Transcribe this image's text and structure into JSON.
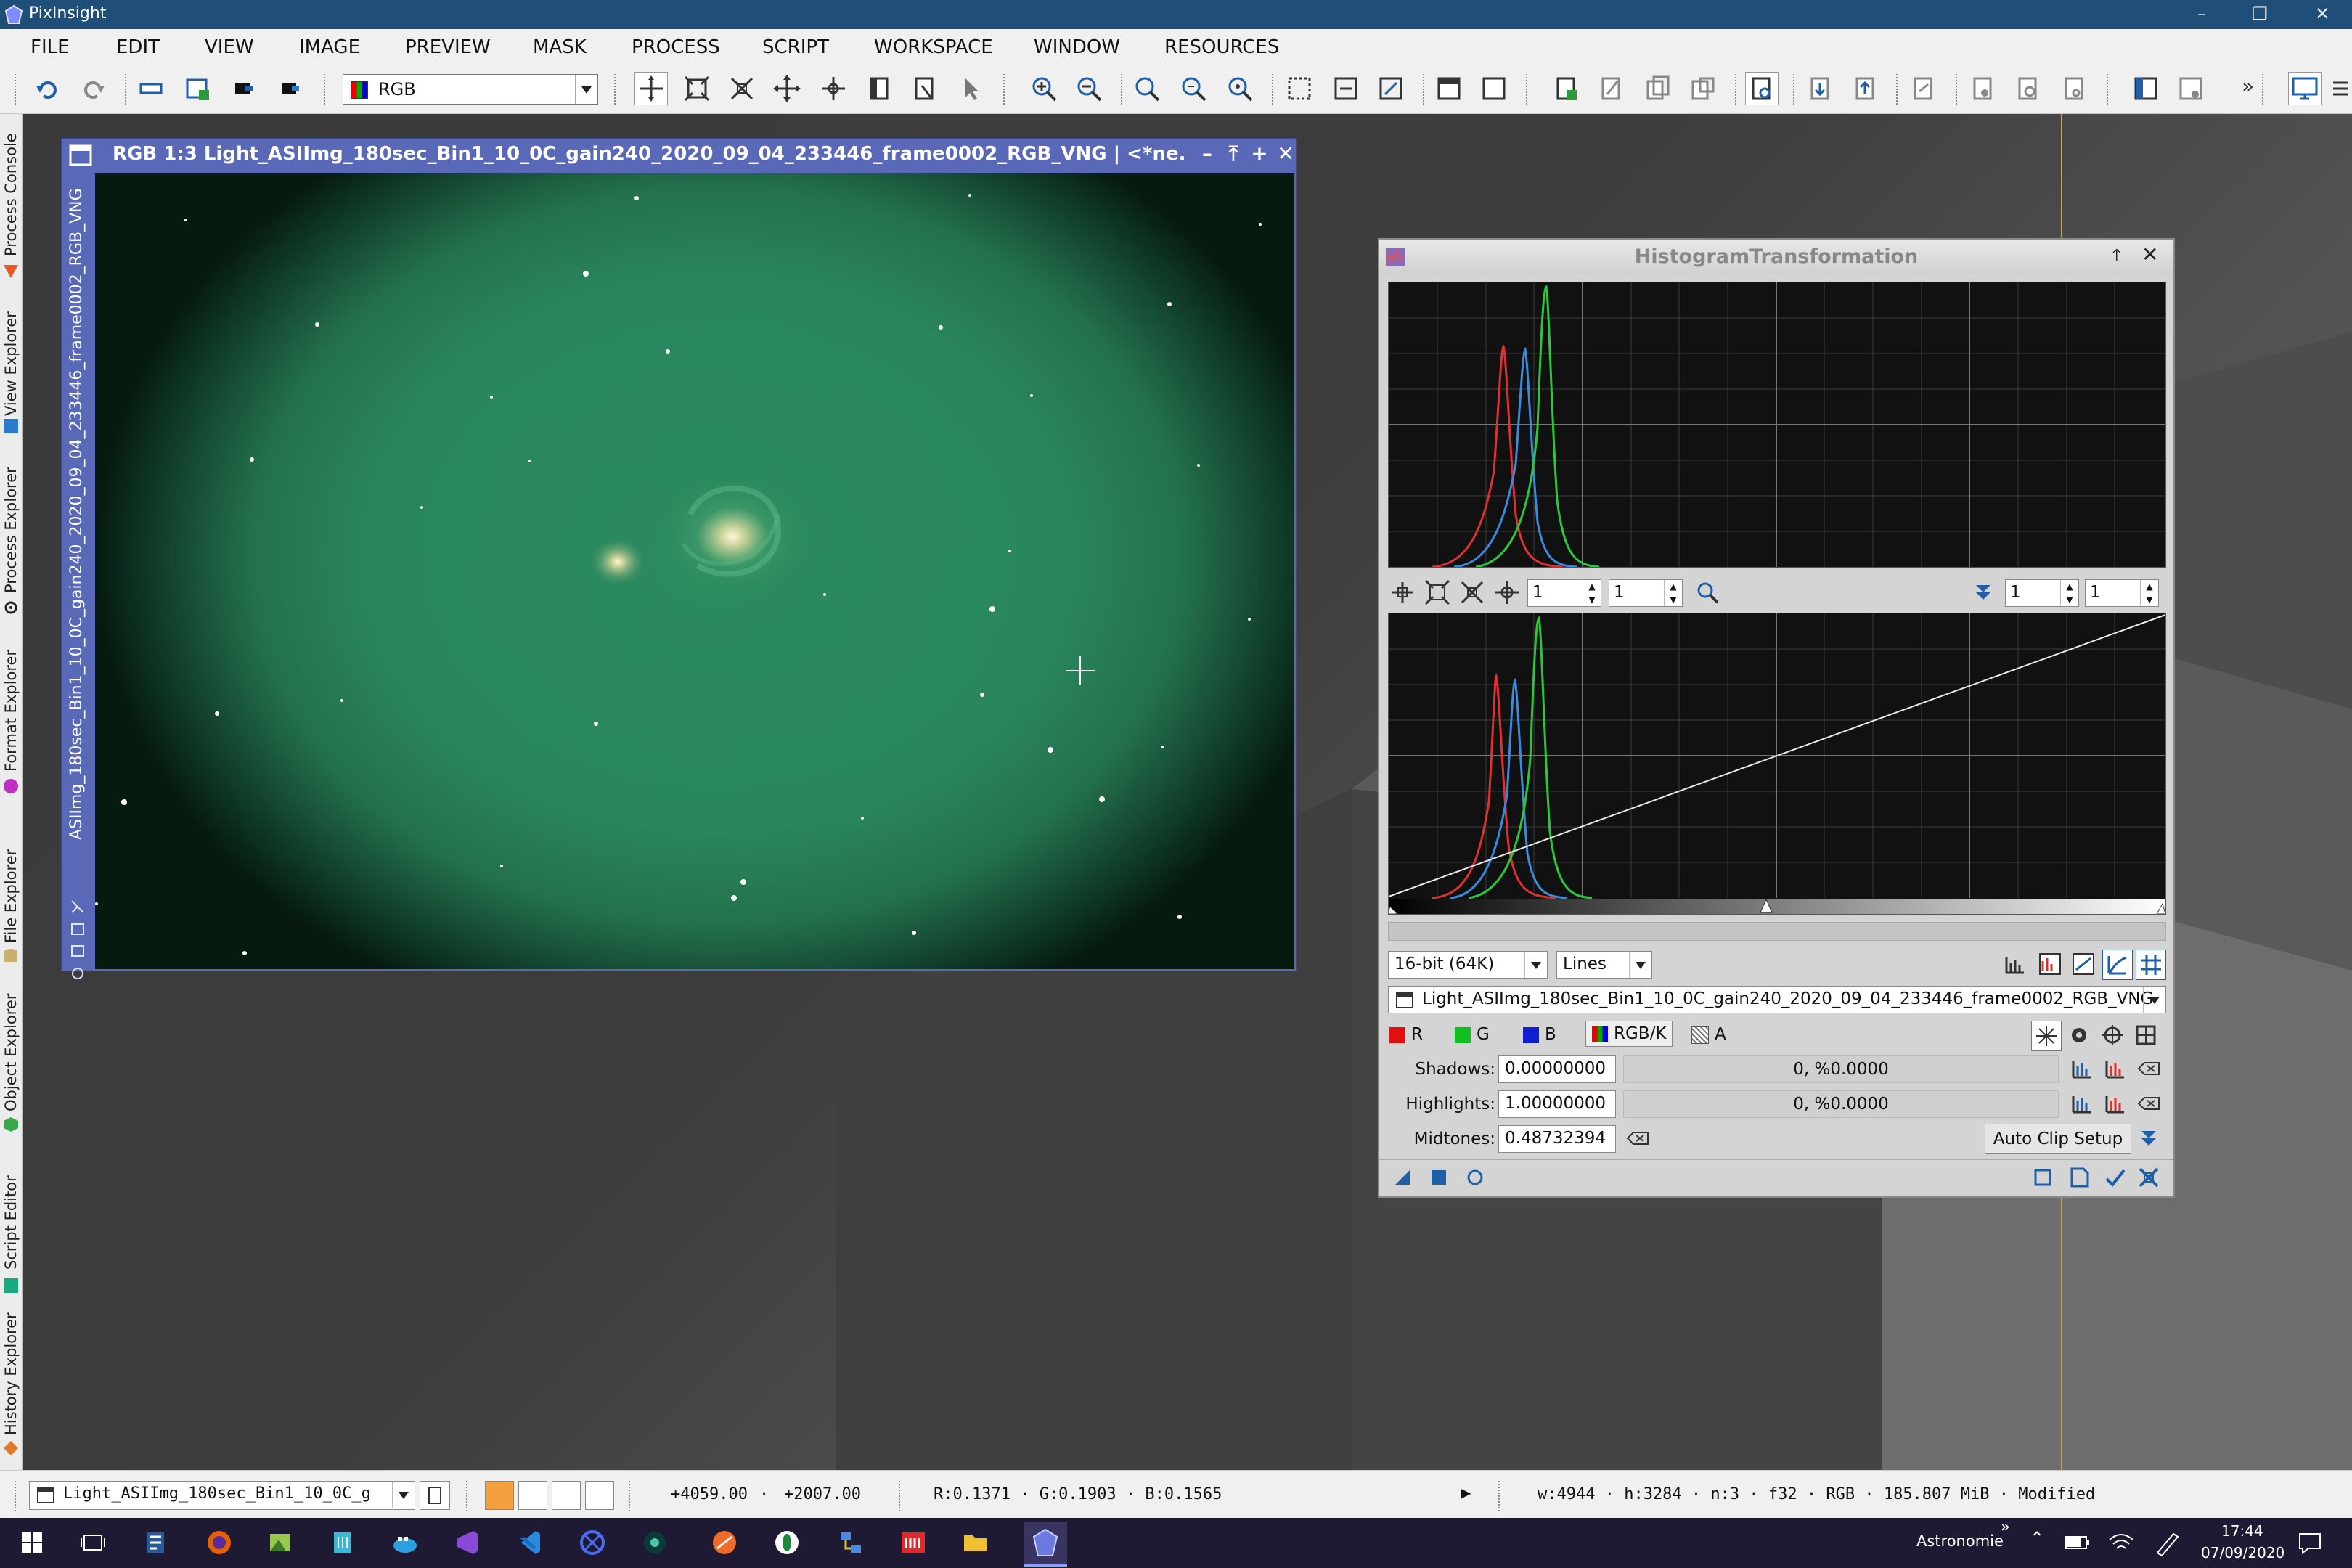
{
  "app": {
    "title": "PixInsight"
  },
  "menu": [
    "FILE",
    "EDIT",
    "VIEW",
    "IMAGE",
    "PREVIEW",
    "MASK",
    "PROCESS",
    "SCRIPT",
    "WORKSPACE",
    "WINDOW",
    "RESOURCES"
  ],
  "toolbar": {
    "channel_select": "RGB",
    "overflow": "»"
  },
  "left_dock": [
    "Process Console",
    "View Explorer",
    "Process Explorer",
    "Format Explorer",
    "File Explorer",
    "Object Explorer",
    "Script Editor",
    "History Explorer"
  ],
  "image_window": {
    "title": "RGB 1:3 Light_ASIImg_180sec_Bin1_10_0C_gain240_2020_09_04_233446_frame0002_RGB_VNG | <*ne...",
    "side_id": "ASIImg_180sec_Bin1_10_0C_gain240_2020_09_04_233446_frame0002_RGB_VNG"
  },
  "histogram": {
    "title": "HistogramTransformation",
    "zoom_h": "1",
    "zoom_v": "1",
    "zoom_h2": "1",
    "zoom_v2": "1",
    "resolution": "16-bit (64K)",
    "graph_style": "Lines",
    "view": "Light_ASIImg_180sec_Bin1_10_0C_gain240_2020_09_04_233446_frame0002_RGB_VNG",
    "channels": {
      "r": "R",
      "g": "G",
      "b": "B",
      "rgbk": "RGB/K",
      "a": "A"
    },
    "shadows_label": "Shadows:",
    "shadows": "0.00000000",
    "shadows_clip": "0, %0.0000",
    "highlights_label": "Highlights:",
    "highlights": "1.00000000",
    "highlights_clip": "0, %0.0000",
    "midtones_label": "Midtones:",
    "midtones": "0.48732394",
    "auto_clip": "Auto Clip Setup"
  },
  "status": {
    "view": "Light_ASIImg_180sec_Bin1_10_0C_g",
    "x": "+4059.00",
    "y": "+2007.00",
    "rgb": "R:0.1371 · G:0.1903 · B:0.1565",
    "info": "w:4944 · h:3284 · n:3 · f32 · RGB · 185.807 MiB · Modified",
    "sep": "·"
  },
  "taskbar": {
    "user": "Astronomie",
    "time": "17:44",
    "date": "07/09/2020",
    "chevron": "»"
  }
}
